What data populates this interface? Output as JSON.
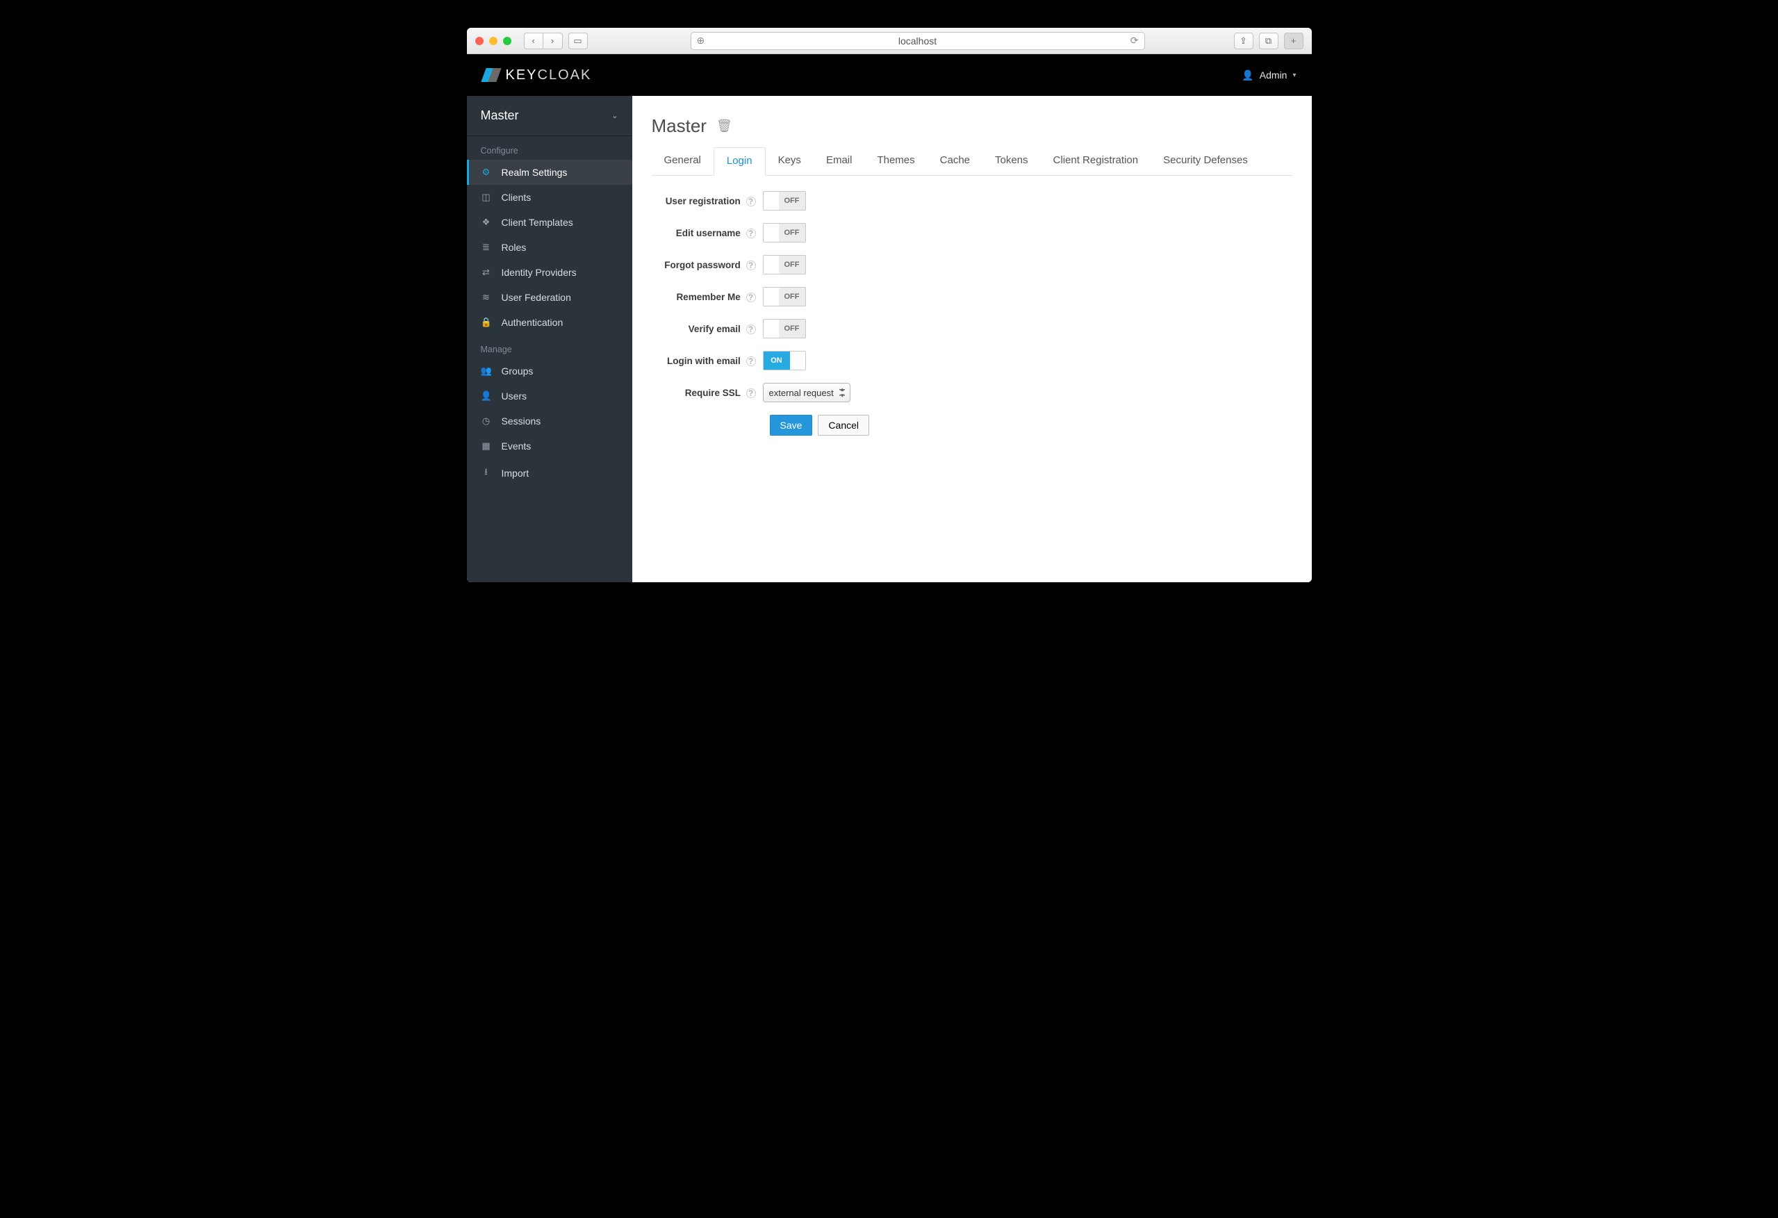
{
  "browser": {
    "host": "localhost"
  },
  "header": {
    "brand_prefix": "KEY",
    "brand_suffix": "CLOAK",
    "user_label": "Admin"
  },
  "sidebar": {
    "realm_selector": "Master",
    "section_configure": "Configure",
    "section_manage": "Manage",
    "configure_items": [
      {
        "label": "Realm Settings"
      },
      {
        "label": "Clients"
      },
      {
        "label": "Client Templates"
      },
      {
        "label": "Roles"
      },
      {
        "label": "Identity Providers"
      },
      {
        "label": "User Federation"
      },
      {
        "label": "Authentication"
      }
    ],
    "manage_items": [
      {
        "label": "Groups"
      },
      {
        "label": "Users"
      },
      {
        "label": "Sessions"
      },
      {
        "label": "Events"
      },
      {
        "label": "Import"
      }
    ]
  },
  "page": {
    "title": "Master",
    "tabs": [
      {
        "label": "General"
      },
      {
        "label": "Login"
      },
      {
        "label": "Keys"
      },
      {
        "label": "Email"
      },
      {
        "label": "Themes"
      },
      {
        "label": "Cache"
      },
      {
        "label": "Tokens"
      },
      {
        "label": "Client Registration"
      },
      {
        "label": "Security Defenses"
      }
    ],
    "active_tab": "Login"
  },
  "form": {
    "rows": [
      {
        "label": "User registration",
        "state": "OFF"
      },
      {
        "label": "Edit username",
        "state": "OFF"
      },
      {
        "label": "Forgot password",
        "state": "OFF"
      },
      {
        "label": "Remember Me",
        "state": "OFF"
      },
      {
        "label": "Verify email",
        "state": "OFF"
      },
      {
        "label": "Login with email",
        "state": "ON"
      }
    ],
    "require_ssl_label": "Require SSL",
    "require_ssl_value": "external request",
    "save_label": "Save",
    "cancel_label": "Cancel"
  }
}
